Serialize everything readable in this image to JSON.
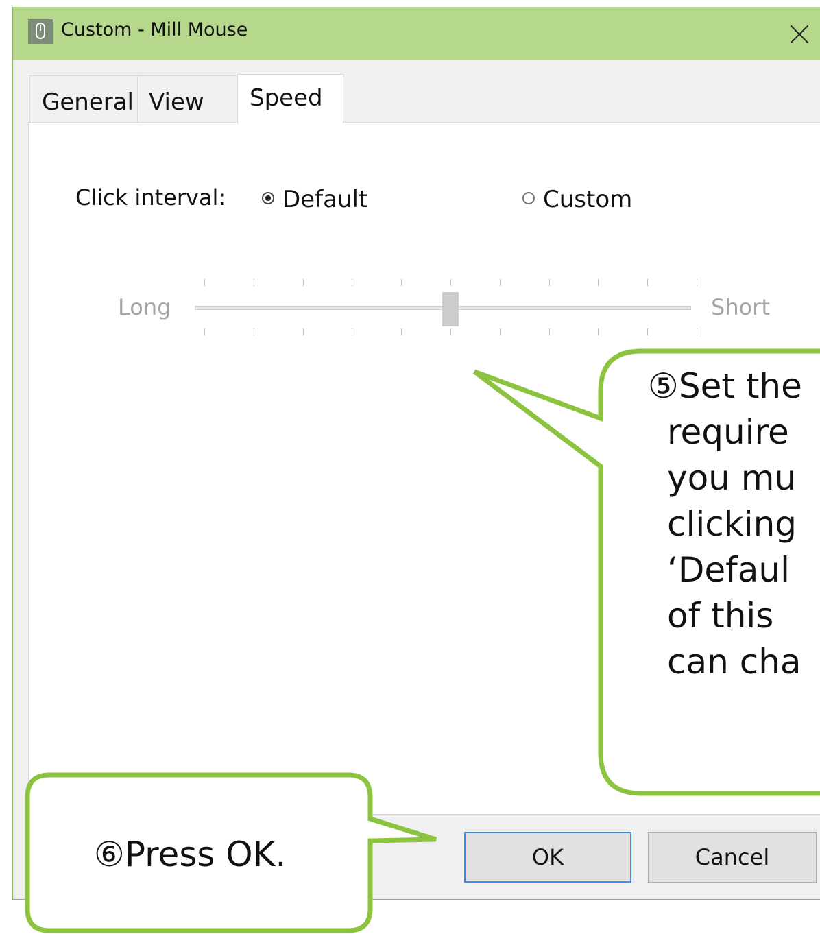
{
  "window": {
    "title": "Custom - Mill Mouse",
    "titlebar_color": "#b5d88d",
    "icon": "mouse-icon",
    "close_icon": "close-icon"
  },
  "tabs": [
    {
      "label": "General",
      "selected": false
    },
    {
      "label": "View",
      "selected": false
    },
    {
      "label": "Speed",
      "selected": true
    }
  ],
  "speed": {
    "click_interval_label": "Click interval:",
    "radio_default_label": "Default",
    "radio_custom_label": "Custom",
    "selected_option": "Default",
    "slider": {
      "min_label": "Long",
      "max_label": "Short",
      "tick_count": 11,
      "position_fraction": 0.5,
      "enabled": false
    }
  },
  "buttons": {
    "ok_label": "OK",
    "cancel_label": "Cancel"
  },
  "callouts": {
    "accent_color": "#8cc43f",
    "step5_lines": [
      "⑤Set the",
      "require",
      "you mu",
      "clicking",
      "‘Defaul",
      "of this",
      "can cha"
    ],
    "step6_text": "⑥Press OK."
  }
}
